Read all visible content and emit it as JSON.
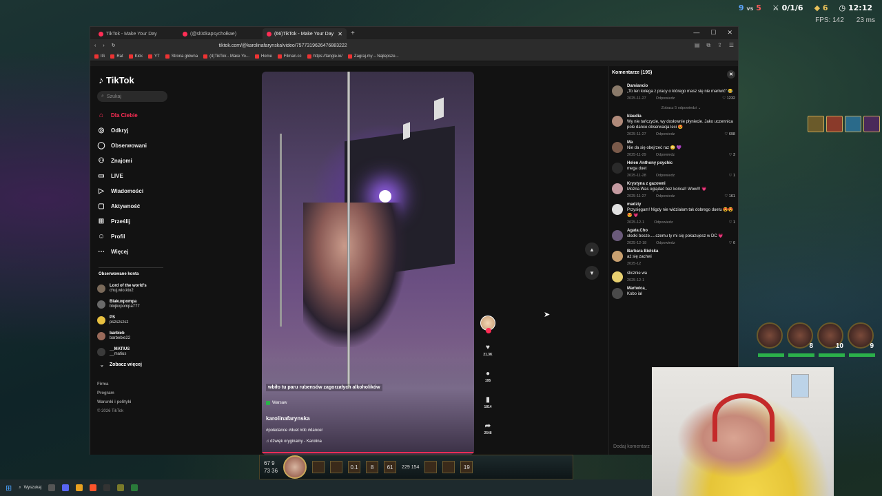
{
  "game": {
    "score_blue": "9",
    "score_vs": "vs",
    "score_red": "5",
    "kda": "0/1/6",
    "gold": "6",
    "time": "12:12",
    "fps": "FPS: 142",
    "ping": "23 ms",
    "bottom_stats": [
      "67",
      "9",
      "73",
      "36",
      "0.1",
      "8",
      "61",
      "229",
      "154",
      "19"
    ]
  },
  "browser": {
    "tabs": [
      {
        "label": "TikTok - Make Your Day",
        "active": false
      },
      {
        "label": "(@sl0dkapsychołkae)",
        "active": false
      },
      {
        "label": "(66)TikTok - Make Your Day",
        "active": true
      }
    ],
    "new_tab": "+",
    "url": "tiktok.com/@karolinafarynska/video/7577319626476883222",
    "bookmarks": [
      "IG",
      "Rat",
      "Kick",
      "YT",
      "Strona główna",
      "(4)TikTok - Make Yo...",
      "Home",
      "Filman.cc",
      "https://tangle.io/",
      "Zagraj.my – Najlepsze..."
    ]
  },
  "tiktok": {
    "logo": "TikTok",
    "search_placeholder": "Szukaj",
    "nav": [
      {
        "label": "Dla Ciebie",
        "icon": "home-icon"
      },
      {
        "label": "Odkryj",
        "icon": "compass-icon"
      },
      {
        "label": "Obserwowani",
        "icon": "following-icon"
      },
      {
        "label": "Znajomi",
        "icon": "friends-icon"
      },
      {
        "label": "LIVE",
        "icon": "live-icon"
      },
      {
        "label": "Wiadomości",
        "icon": "messages-icon"
      },
      {
        "label": "Aktywność",
        "icon": "activity-icon"
      },
      {
        "label": "Prześlij",
        "icon": "upload-icon"
      },
      {
        "label": "Profil",
        "icon": "profile-icon"
      },
      {
        "label": "Więcej",
        "icon": "more-icon"
      }
    ],
    "following_title": "Obserwowane konta",
    "following": [
      {
        "name": "Lord of the world's",
        "handle": "chuj.wio.kto2"
      },
      {
        "name": "Blakuxpompa",
        "handle": "blojkxpompa777"
      },
      {
        "name": "PS",
        "handle": "pszszszsz"
      },
      {
        "name": "barbieb",
        "handle": "barbebie22"
      },
      {
        "name": "__MATIUS",
        "handle": "__matius"
      }
    ],
    "see_more": "Zobacz więcej",
    "footer": [
      "Firma",
      "Program",
      "Warunki i polityki",
      "© 2026 TikTok"
    ],
    "video": {
      "caption": "wbiło tu paru rubensów zagorzałych alkoholików",
      "location": "Warsaw",
      "username": "karolinafarynska",
      "tags": "#poledance #duet #dc #dancer",
      "sound": "dźwięk oryginalny - Karolina",
      "likes": "21.3K",
      "comments": "195",
      "saves": "1814",
      "shares": "2548",
      "progress": 1.0
    }
  },
  "comments": {
    "title": "Komentarze (195)",
    "items": [
      {
        "name": "Damiancio",
        "text": "„To ten kolega z pracy o którego masz się nie martwić” 😂",
        "date": "2025-11-27",
        "reply": "Odpowiedz",
        "likes": "1232",
        "replies": "Zobacz 5 odpowiedzi"
      },
      {
        "name": "klaudia",
        "text": "Wy nie tańczycie, wy dosłownie płyniecie. Jako uczennica pole dance obserwacja leci 😍",
        "date": "2025-11-27",
        "reply": "Odpowiedz",
        "likes": "698"
      },
      {
        "name": "Ma",
        "text": "Nie da się obejrzeć raz 😳 💜",
        "date": "2025-11-29",
        "reply": "Odpowiedz",
        "likes": "3"
      },
      {
        "name": "Helen Anthony psychic",
        "text": "mega duet",
        "date": "2025-11-28",
        "reply": "Odpowiedz",
        "likes": "1"
      },
      {
        "name": "Krystyna z gazowni",
        "text": "Można Was oglądać bez końca!! Wow!!! 💗",
        "date": "2025-11-27",
        "reply": "Odpowiedz",
        "likes": "161"
      },
      {
        "name": "madziy",
        "text": "Przysięgam! Nigdy nie widziałam tak dobrego duetu 😍😍😍 💗",
        "date": "2025-12-1",
        "reply": "Odpowiedz",
        "likes": "1"
      },
      {
        "name": "Agata.Cho",
        "text": "słodki bosze.....czemu ty mi się pokazujesz w DC 💗",
        "date": "2025-12-18",
        "reply": "Odpowiedz",
        "likes": "0"
      },
      {
        "name": "Barbara Bielska",
        "text": "aż się zachwi",
        "date": "2025-12",
        "reply": "",
        "likes": ""
      },
      {
        "name": "",
        "text": "ślicznie wa",
        "date": "2025-12-1",
        "reply": "",
        "likes": ""
      },
      {
        "name": "Martwica_",
        "text": "Kobo iał",
        "date": "",
        "reply": "",
        "likes": ""
      }
    ],
    "add_placeholder": "Dodaj komentarz"
  },
  "taskbar": {
    "search": "Wyszukaj"
  }
}
